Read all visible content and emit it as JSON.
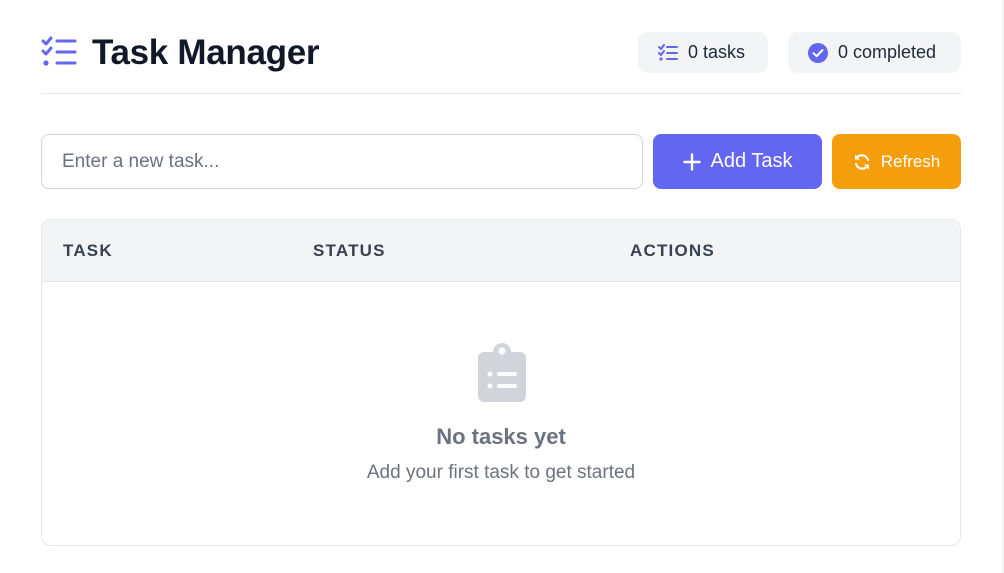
{
  "header": {
    "title": "Task Manager",
    "title_icon": "task-list-icon",
    "badges": {
      "tasks_label": "0 tasks",
      "completed_label": "0 completed"
    }
  },
  "form": {
    "input_placeholder": "Enter a new task...",
    "input_value": "",
    "add_button_label": "Add Task",
    "refresh_button_label": "Refresh"
  },
  "table": {
    "columns": [
      "TASK",
      "STATUS",
      "ACTIONS"
    ],
    "rows": []
  },
  "empty_state": {
    "icon": "clipboard-list-icon",
    "title": "No tasks yet",
    "subtitle": "Add your first task to get started"
  },
  "colors": {
    "accent": "#6366f1",
    "refresh": "#f59e0b",
    "text_dark": "#111827",
    "muted": "#6b7280",
    "badge_bg": "#f3f4f6",
    "empty_icon": "#d1d5db"
  }
}
